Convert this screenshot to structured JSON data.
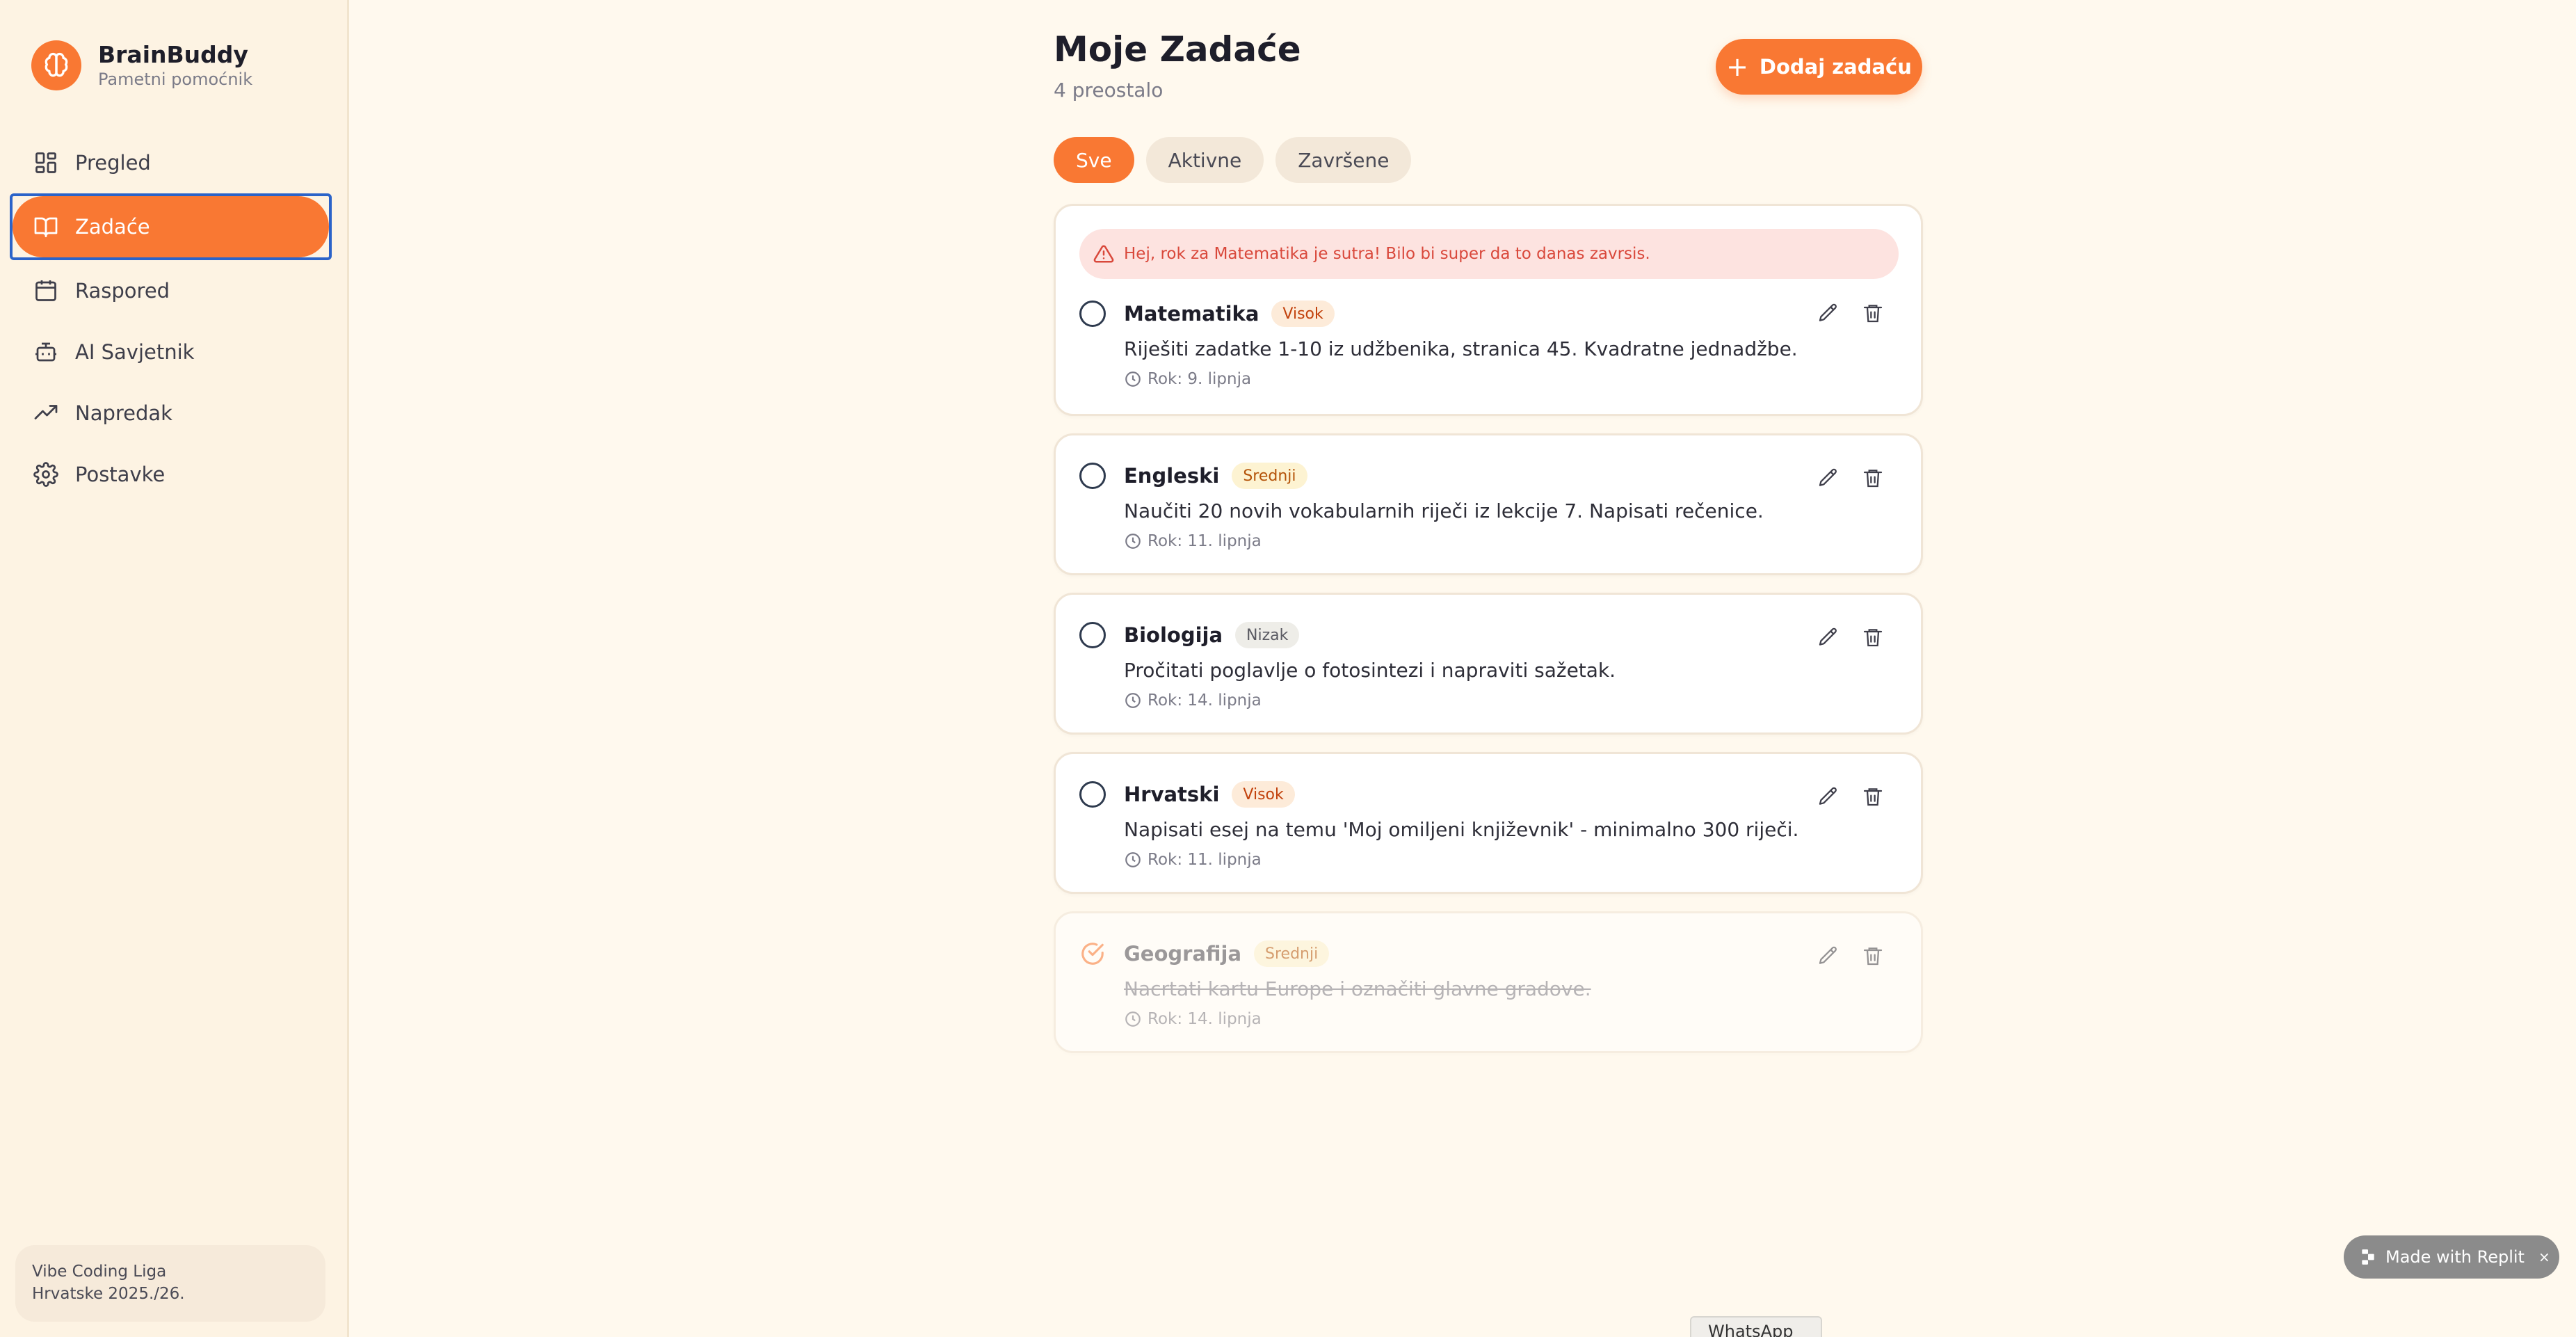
{
  "brand": {
    "name": "BrainBuddy",
    "subtitle": "Pametni pomoćnik"
  },
  "sidebar": {
    "items": [
      {
        "label": "Pregled",
        "icon": "dashboard-icon"
      },
      {
        "label": "Zadaće",
        "icon": "book-icon",
        "active": true
      },
      {
        "label": "Raspored",
        "icon": "calendar-icon"
      },
      {
        "label": "AI Savjetnik",
        "icon": "robot-icon"
      },
      {
        "label": "Napredak",
        "icon": "trending-up-icon"
      },
      {
        "label": "Postavke",
        "icon": "gear-icon"
      }
    ],
    "footer": {
      "line1": "Vibe Coding Liga",
      "line2": "Hrvatske 2025./26."
    }
  },
  "header": {
    "title": "Moje Zadaće",
    "subtitle": "4 preostalo",
    "add_button": "Dodaj zadaću"
  },
  "filters": [
    {
      "label": "Sve",
      "active": true
    },
    {
      "label": "Aktivne"
    },
    {
      "label": "Završene"
    }
  ],
  "alert": {
    "text": "Hej, rok za Matematika je sutra! Bilo bi super da to danas zavrsis."
  },
  "tasks": [
    {
      "title": "Matematika",
      "priority": "Visok",
      "description": "Riješiti zadatke 1-10 iz udžbenika, stranica 45. Kvadratne jednadžbe.",
      "due": "Rok: 9. lipnja",
      "done": false
    },
    {
      "title": "Engleski",
      "priority": "Srednji",
      "description": "Naučiti 20 novih vokabularnih riječi iz lekcije 7. Napisati rečenice.",
      "due": "Rok: 11. lipnja",
      "done": false
    },
    {
      "title": "Biologija",
      "priority": "Nizak",
      "description": "Pročitati poglavlje o fotosintezi i napraviti sažetak.",
      "due": "Rok: 14. lipnja",
      "done": false
    },
    {
      "title": "Hrvatski",
      "priority": "Visok",
      "description": "Napisati esej na temu 'Moj omiljeni književnik' - minimalno 300 riječi.",
      "due": "Rok: 11. lipnja",
      "done": false
    },
    {
      "title": "Geografija",
      "priority": "Srednji",
      "description": "Nacrtati kartu Europe i označiti glavne gradove.",
      "due": "Rok: 14. lipnja",
      "done": true
    }
  ],
  "replit_badge": {
    "label": "Made with Replit",
    "close": "×"
  },
  "taskbar": {
    "label": "WhatsApp"
  },
  "colors": {
    "accent": "#F97833",
    "background": "#FFF9EE",
    "sidebar": "#FDF3E3"
  }
}
